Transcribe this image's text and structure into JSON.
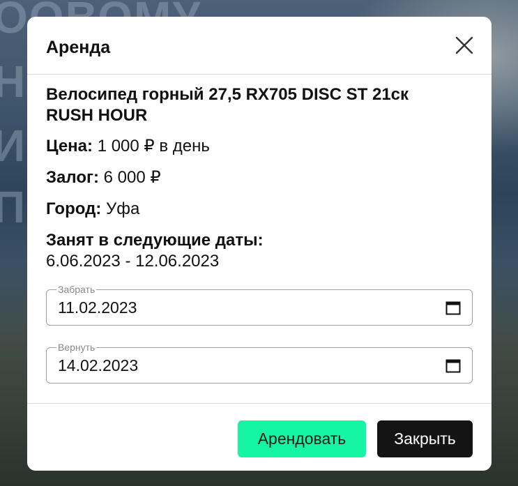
{
  "background": {
    "text_lines": [
      "ООВОМУ",
      "Н",
      "И",
      "П"
    ]
  },
  "modal": {
    "title": "Аренда",
    "product_name": "Велосипед горный 27,5 RX705 DISC ST 21ск RUSH HOUR",
    "price_label": "Цена:",
    "price_value": "1 000 ₽ в день",
    "deposit_label": "Залог:",
    "deposit_value": "6 000 ₽",
    "city_label": "Город:",
    "city_value": "Уфа",
    "busy_label": "Занят в следующие даты:",
    "busy_dates": "6.06.2023 - 12.06.2023",
    "pickup": {
      "label": "Забрать",
      "value": "11.02.2023"
    },
    "return": {
      "label": "Вернуть",
      "value": "14.02.2023"
    },
    "rent_button": "Арендовать",
    "close_button": "Закрыть"
  },
  "colors": {
    "rent_button": "#16f5a4",
    "close_button": "#141414"
  },
  "icons": {
    "close": "close-icon",
    "calendar": "calendar-icon"
  }
}
